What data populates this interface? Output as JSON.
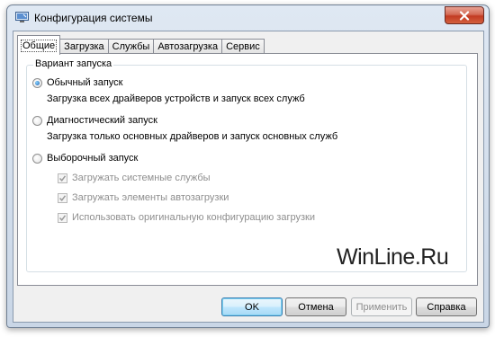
{
  "window": {
    "title": "Конфигурация системы"
  },
  "tabs": [
    {
      "label": "Общие",
      "active": true
    },
    {
      "label": "Загрузка",
      "active": false
    },
    {
      "label": "Службы",
      "active": false
    },
    {
      "label": "Автозагрузка",
      "active": false
    },
    {
      "label": "Сервис",
      "active": false
    }
  ],
  "startup_group": {
    "legend": "Вариант запуска",
    "normal": {
      "label": "Обычный запуск",
      "description": "Загрузка всех драйверов устройств и запуск всех служб",
      "checked": true
    },
    "diagnostic": {
      "label": "Диагностический запуск",
      "description": "Загрузка только основных драйверов и запуск основных служб",
      "checked": false
    },
    "selective": {
      "label": "Выборочный запуск",
      "checked": false,
      "options": [
        {
          "label": "Загружать системные службы",
          "checked": true,
          "disabled": true
        },
        {
          "label": "Загружать элементы автозагрузки",
          "checked": true,
          "disabled": true
        },
        {
          "label": "Использовать оригинальную конфигурацию загрузки",
          "checked": true,
          "disabled": true
        }
      ]
    }
  },
  "watermark": "WinLine.Ru",
  "buttons": {
    "ok": "OK",
    "cancel": "Отмена",
    "apply": "Применить",
    "help": "Справка"
  },
  "colors": {
    "accent": "#1c5db0",
    "close": "#c23a22",
    "disabled_text": "#8e8e8e"
  }
}
